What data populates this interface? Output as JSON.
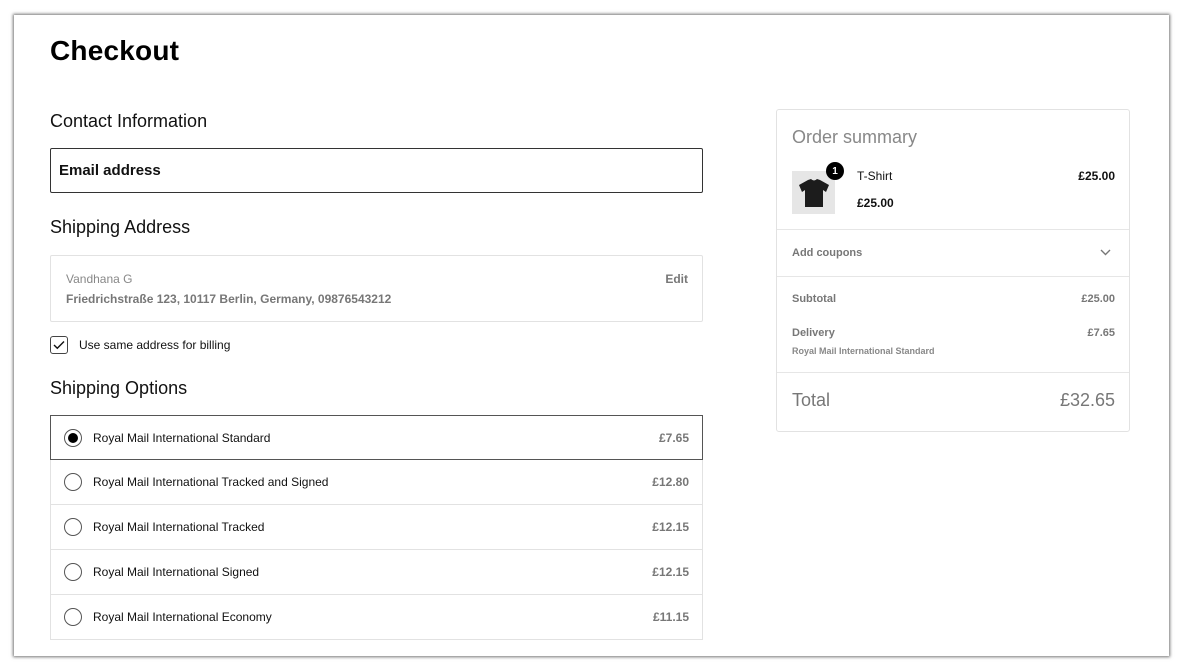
{
  "page_title": "Checkout",
  "contact": {
    "heading": "Contact Information",
    "email_placeholder": "Email address"
  },
  "shipping_address": {
    "heading": "Shipping Address",
    "name": "Vandhana G",
    "address": "Friedrichstraße 123, 10117 Berlin, Germany, 09876543212",
    "edit_label": "Edit"
  },
  "billing": {
    "label": "Use same address for billing",
    "checked": true
  },
  "shipping_options": {
    "heading": "Shipping Options",
    "options": [
      {
        "label": "Royal Mail International Standard",
        "price": "£7.65",
        "selected": true
      },
      {
        "label": "Royal Mail International Tracked and Signed",
        "price": "£12.80",
        "selected": false
      },
      {
        "label": "Royal Mail International Tracked",
        "price": "£12.15",
        "selected": false
      },
      {
        "label": "Royal Mail International Signed",
        "price": "£12.15",
        "selected": false
      },
      {
        "label": "Royal Mail International Economy",
        "price": "£11.15",
        "selected": false
      }
    ]
  },
  "order_summary": {
    "title": "Order summary",
    "item": {
      "name": "T-Shirt",
      "quantity": "1",
      "unit_price": "£25.00",
      "line_total": "£25.00",
      "icon": "tshirt-icon"
    },
    "coupons_label": "Add coupons",
    "subtotal_label": "Subtotal",
    "subtotal_value": "£25.00",
    "delivery_label": "Delivery",
    "delivery_value": "£7.65",
    "delivery_method": "Royal Mail International Standard",
    "total_label": "Total",
    "total_value": "£32.65"
  }
}
